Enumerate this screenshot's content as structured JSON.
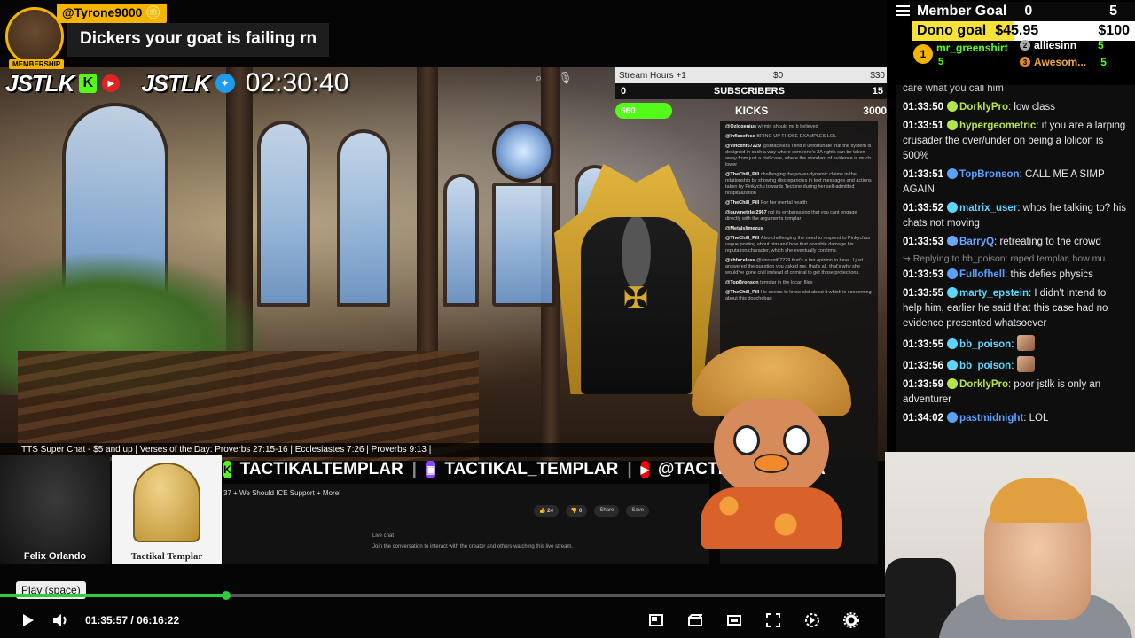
{
  "superchat": {
    "username": "@Tyrone9000",
    "badge": "MEMBERSHIP",
    "message": "Dickers your goat is failing rn"
  },
  "overlay": {
    "logo_text": "JSTLK",
    "stream_time": "02:30:40",
    "ticker": "TTS Super Chat - $5 and up | Verses of the Day: Proverbs 27:15-16 | Ecclesiastes 7:26 | Proverbs 9:13 |",
    "socials": [
      "TACTIKALTEMPLAR",
      "TACTIKAL_TEMPLAR",
      "@TACTIKALTEMPLA"
    ],
    "yt_title": "37 + We Should ICE Support + More!",
    "yt_actions": [
      "24",
      "0",
      "Share",
      "Save"
    ],
    "yt_livechat_title": "Live chat",
    "yt_livechat_hint": "Join the conversation to interact with the creator and others watching this live stream.",
    "cam_left_name": "Felix Orlando",
    "cam_right_name": "Tactikal Templar"
  },
  "stats": {
    "row1_label": "Stream Hours +1",
    "row1_mid": "$0",
    "row1_right": "$30",
    "subs_left": "0",
    "subs_label": "SUBSCRIBERS",
    "subs_right": "15",
    "kicks_pill": "660",
    "kicks_label": "KICKS",
    "kicks_max": "3000"
  },
  "inner_chat": [
    {
      "user": "@Ozlogenius",
      "text": "wirmin should mr b believed"
    },
    {
      "user": "@Inflacefess",
      "text": "BRING UP THOSE EXAMPLES LOL"
    },
    {
      "user": "@vincent67229",
      "text": "@shfaceless I find it unfortunate that the system is designed in such a way where someone's 2A rights can be taken away from just a civil case, where the standard of evidence is much lower"
    },
    {
      "user": "@TheChill_Pill",
      "text": "challenging the power-dynamic claims in the relationship by showing discrepancies in text messages and actions taken by Pinkychu towards Tectone during her self-admitted hospitalization"
    },
    {
      "user": "@TheChill_Pill",
      "text": "For her mental health"
    },
    {
      "user": "@guymetzler2967",
      "text": "ngl its embarassing that you cant engage directly with the arguments templar"
    },
    {
      "user": "@Metalslimezus",
      "text": ""
    },
    {
      "user": "@TheChill_Pill",
      "text": "Also challenging the need to respond to Pinkychus vague posting about him and how that possible damage his reputation/character, which she eventually confirms."
    },
    {
      "user": "@shfaceless",
      "text": "@vincent67229 that's a fair opinion to have. I just answered the question you asked me. that's all. that's why she would've gone civil instead of criminal to get those protections."
    },
    {
      "user": "@TopBronson",
      "text": "templar in the locari files"
    },
    {
      "user": "@TheChill_Pill",
      "text": "He seems to know alot about it which is concerning about this douchebag"
    }
  ],
  "player": {
    "tooltip": "Play (space)",
    "current_time": "01:35:57",
    "separator": "/",
    "duration": "06:16:22",
    "progress": 0.255
  },
  "goals": {
    "member_label": "Member Goal",
    "member_current": "0",
    "member_target": "5",
    "dono_label": "Dono goal",
    "dono_current": "$45.95",
    "dono_target": "$100",
    "dono_fraction": 0.4595
  },
  "leaderboard": [
    {
      "rank": "1",
      "name": "mr_greenshirt",
      "count": "5"
    },
    {
      "rank": "2",
      "name": "alliesinn",
      "count": "5"
    },
    {
      "rank": "3",
      "name": "Awesom...",
      "count": "5"
    }
  ],
  "chat": {
    "partial_top": "care what you call him",
    "messages": [
      {
        "time": "01:33:50",
        "user": "DorklyPro",
        "color": "#b5e34a",
        "text": "low class"
      },
      {
        "time": "01:33:51",
        "user": "hypergeometric",
        "color": "#b5e34a",
        "text": "if you are a larping crusader the over/under on being a lolicon is 500%"
      },
      {
        "time": "01:33:51",
        "user": "TopBronson",
        "color": "#5aa0ff",
        "text": "CALL ME A SIMP AGAIN"
      },
      {
        "time": "01:33:52",
        "user": "matrix_user",
        "color": "#5dd6ff",
        "text": "whos he talking to? his chats not moving"
      },
      {
        "time": "01:33:53",
        "user": "BarryQ",
        "color": "#6aa6ff",
        "text": "retreating to the crowd"
      },
      {
        "time": "01:33:53",
        "user": "Fullofhell",
        "color": "#5aa0ff",
        "text": "this defies physics",
        "reply": "Replying to bb_poison: raped templar, how mu..."
      },
      {
        "time": "01:33:55",
        "user": "marty_epstein",
        "color": "#5dd6ff",
        "text": "I didn't intend to help him, earlier he said that this case had no evidence presented whatsoever"
      },
      {
        "time": "01:33:55",
        "user": "bb_poison",
        "color": "#5dd6ff",
        "text": ""
      },
      {
        "time": "01:33:56",
        "user": "bb_poison",
        "color": "#5dd6ff",
        "text": ""
      },
      {
        "time": "01:33:59",
        "user": "DorklyPro",
        "color": "#b5e34a",
        "text": "poor jstlk is only an adventurer"
      },
      {
        "time": "01:34:02",
        "user": "pastmidnight",
        "color": "#5aa0ff",
        "text": "LOL"
      }
    ]
  },
  "colors": {
    "accent_green": "#2ecc40",
    "kick_green": "#53fc18",
    "superchat_gold": "#f5b400",
    "dono_yellow": "#f5e23a"
  }
}
